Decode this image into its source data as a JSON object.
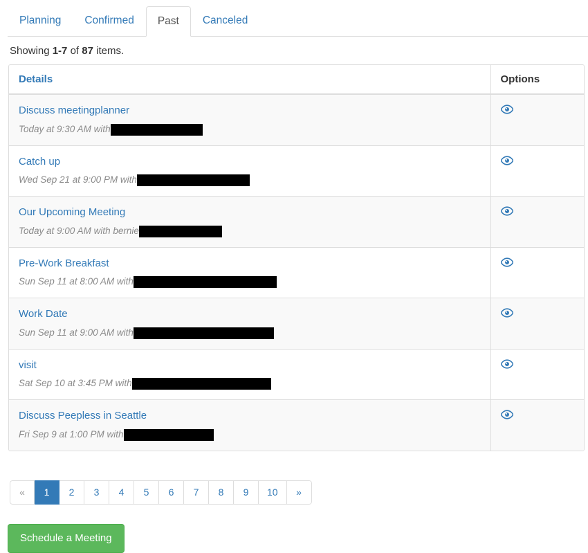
{
  "tabs": [
    {
      "label": "Planning",
      "active": false
    },
    {
      "label": "Confirmed",
      "active": false
    },
    {
      "label": "Past",
      "active": true
    },
    {
      "label": "Canceled",
      "active": false
    }
  ],
  "summary": {
    "prefix": "Showing ",
    "range": "1-7",
    "middle": " of ",
    "total": "87",
    "suffix": " items."
  },
  "table": {
    "headers": {
      "details": "Details",
      "options": "Options"
    },
    "rows": [
      {
        "title": "Discuss meetingplanner",
        "subtitle": "Today at 9:30 AM with",
        "redaction_width": 133,
        "option_icon": "eye-icon"
      },
      {
        "title": "Catch up",
        "subtitle": "Wed Sep 21 at 9:00 PM with",
        "redaction_width": 163,
        "option_icon": "eye-icon"
      },
      {
        "title": "Our Upcoming Meeting",
        "subtitle": "Today at 9:00 AM with bernie",
        "redaction_width": 120,
        "option_icon": "eye-icon"
      },
      {
        "title": "Pre-Work Breakfast",
        "subtitle": "Sun Sep 11 at 8:00 AM with",
        "redaction_width": 207,
        "option_icon": "eye-icon"
      },
      {
        "title": "Work Date",
        "subtitle": "Sun Sep 11 at 9:00 AM with",
        "redaction_width": 203,
        "option_icon": "eye-icon"
      },
      {
        "title": "visit",
        "subtitle": "Sat Sep 10 at 3:45 PM with",
        "redaction_width": 201,
        "option_icon": "eye-icon"
      },
      {
        "title": "Discuss Peepless in Seattle",
        "subtitle": "Fri Sep 9 at 1:00 PM with",
        "redaction_width": 130,
        "option_icon": "eye-icon"
      }
    ]
  },
  "pagination": [
    {
      "label": "«",
      "state": "disabled",
      "name": "pagination-prev"
    },
    {
      "label": "1",
      "state": "active",
      "name": "pagination-page-1"
    },
    {
      "label": "2",
      "state": "",
      "name": "pagination-page-2"
    },
    {
      "label": "3",
      "state": "",
      "name": "pagination-page-3"
    },
    {
      "label": "4",
      "state": "",
      "name": "pagination-page-4"
    },
    {
      "label": "5",
      "state": "",
      "name": "pagination-page-5"
    },
    {
      "label": "6",
      "state": "",
      "name": "pagination-page-6"
    },
    {
      "label": "7",
      "state": "",
      "name": "pagination-page-7"
    },
    {
      "label": "8",
      "state": "",
      "name": "pagination-page-8"
    },
    {
      "label": "9",
      "state": "",
      "name": "pagination-page-9"
    },
    {
      "label": "10",
      "state": "",
      "name": "pagination-page-10"
    },
    {
      "label": "»",
      "state": "",
      "name": "pagination-next"
    }
  ],
  "actions": {
    "schedule_label": "Schedule a Meeting"
  },
  "colors": {
    "link": "#337ab7",
    "active_tab_text": "#555555",
    "muted": "#8a8a8a",
    "border": "#dddddd",
    "stripe": "#f9f9f9",
    "success": "#5cb85c",
    "redaction": "#000000"
  }
}
